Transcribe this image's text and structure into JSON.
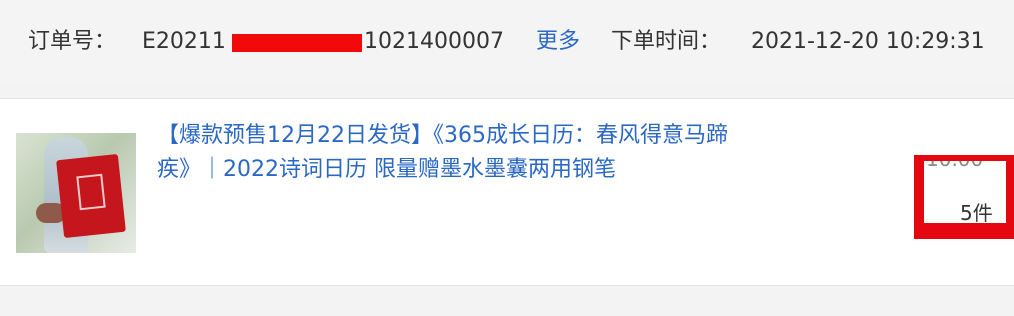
{
  "order": {
    "label": "订单号：",
    "number_prefix": "E20211",
    "number_suffix": "1021400007",
    "more_link": "更多",
    "time_label": "下单时间：",
    "time_value": "2021-12-20 10:29:31"
  },
  "item": {
    "title": "【爆款预售12月22日发货】《365成长日历：春风得意马蹄疾》｜2022诗词日历 限量赠墨水墨囊两用钢笔",
    "quantity": "5件",
    "price_partial": "10.00"
  },
  "colors": {
    "link": "#2b68c6",
    "redaction": "#e5070f"
  }
}
